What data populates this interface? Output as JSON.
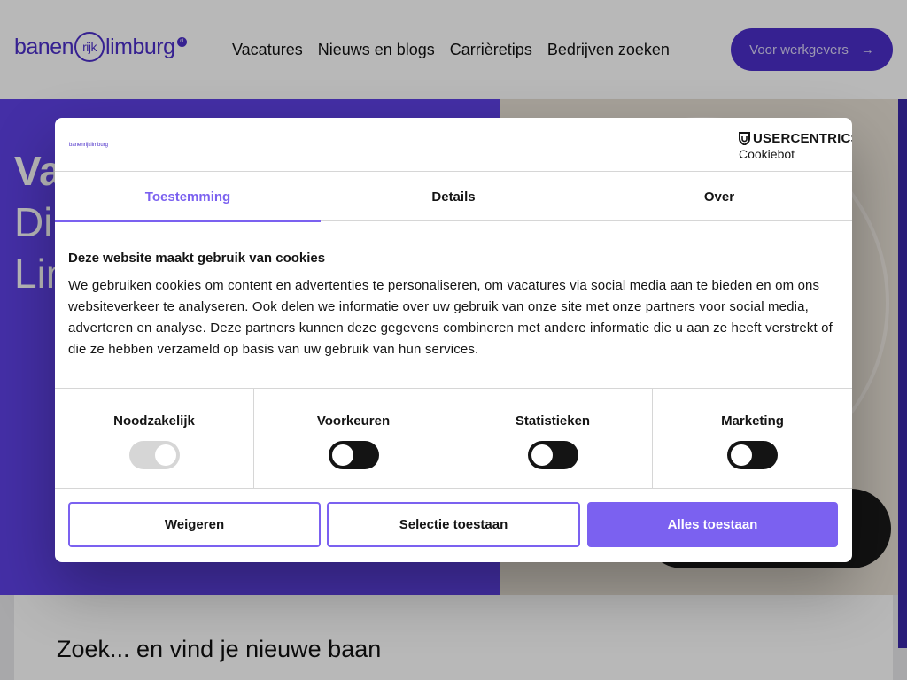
{
  "site": {
    "logo": {
      "part1": "banen",
      "part2": "rijk",
      "part3": "limburg",
      "badge": "nl"
    },
    "nav": [
      {
        "label": "Vacatures"
      },
      {
        "label": "Nieuws en blogs"
      },
      {
        "label": "Carrièretips"
      },
      {
        "label": "Bedrijven zoeken"
      }
    ],
    "employer_button": {
      "label": "Voor werkgevers",
      "icon": "arrow-right-icon"
    },
    "hero": {
      "line1": "Va",
      "line2": "Di",
      "line3": "Lin"
    },
    "search_heading": "Zoek... en vind je nieuwe baan"
  },
  "dialog": {
    "mini_logo": "banenrijklimburg",
    "brand": {
      "name": "USERCENTRICS",
      "sub": "Cookiebot",
      "icon": "usercentrics-shield-icon"
    },
    "tabs": [
      {
        "label": "Toestemming",
        "active": true
      },
      {
        "label": "Details",
        "active": false
      },
      {
        "label": "Over",
        "active": false
      }
    ],
    "title": "Deze website maakt gebruik van cookies",
    "text": "We gebruiken cookies om content en advertenties te personaliseren, om vacatures via social media aan te bieden en om ons websiteverkeer te analyseren. Ook delen we informatie over uw gebruik van onze site met onze partners voor social media, adverteren en analyse. Deze partners kunnen deze gegevens combineren met andere informatie die u aan ze heeft verstrekt of die ze hebben verzameld op basis van uw gebruik van hun services.",
    "categories": [
      {
        "label": "Noodzakelijk",
        "enabled": true,
        "locked": true
      },
      {
        "label": "Voorkeuren",
        "enabled": false,
        "locked": false
      },
      {
        "label": "Statistieken",
        "enabled": false,
        "locked": false
      },
      {
        "label": "Marketing",
        "enabled": false,
        "locked": false
      }
    ],
    "buttons": {
      "decline": "Weigeren",
      "selection": "Selectie toestaan",
      "allow_all": "Alles toestaan"
    },
    "colors": {
      "accent": "#7b61f0",
      "brand_purple": "#4b2fc9"
    }
  }
}
